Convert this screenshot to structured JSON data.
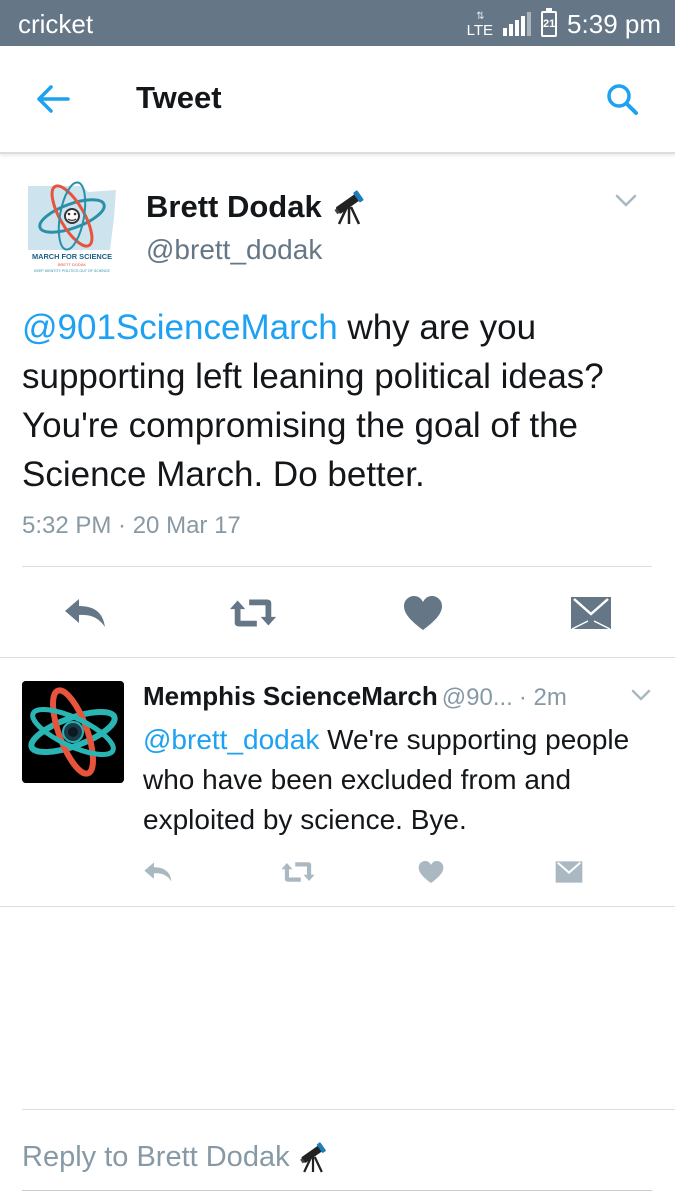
{
  "status_bar": {
    "carrier": "cricket",
    "network": "LTE",
    "battery_level": "21",
    "time": "5:39 pm"
  },
  "header": {
    "title": "Tweet",
    "back_icon": "arrow-left-icon",
    "search_icon": "search-icon"
  },
  "tweet": {
    "avatar_text": {
      "line1": "MARCH FOR SCIENCE",
      "line2": "BRETT DODAK",
      "line3": "KEEP IDENTITY POLITICS OUT OF SCIENCE"
    },
    "author_name": "Brett Dodak",
    "author_emoji": "telescope-icon",
    "author_handle": "@brett_dodak",
    "mention": "@901ScienceMarch",
    "text": " why are you supporting left leaning political ideas? You're compromising the goal of the Science March. Do better.",
    "timestamp": "5:32 PM · 20 Mar 17"
  },
  "reply": {
    "author_name": "Memphis ScienceMarch",
    "author_handle": "@90...",
    "time": "· 2m",
    "mention": "@brett_dodak",
    "text": " We're supporting people who have been excluded from and exploited by science. Bye."
  },
  "composer": {
    "placeholder": "Reply to Brett Dodak"
  },
  "colors": {
    "status_bar": "#657786",
    "accent": "#1da1f2",
    "action_icon_main": "#657786",
    "action_icon_reply": "#aab8c2"
  }
}
